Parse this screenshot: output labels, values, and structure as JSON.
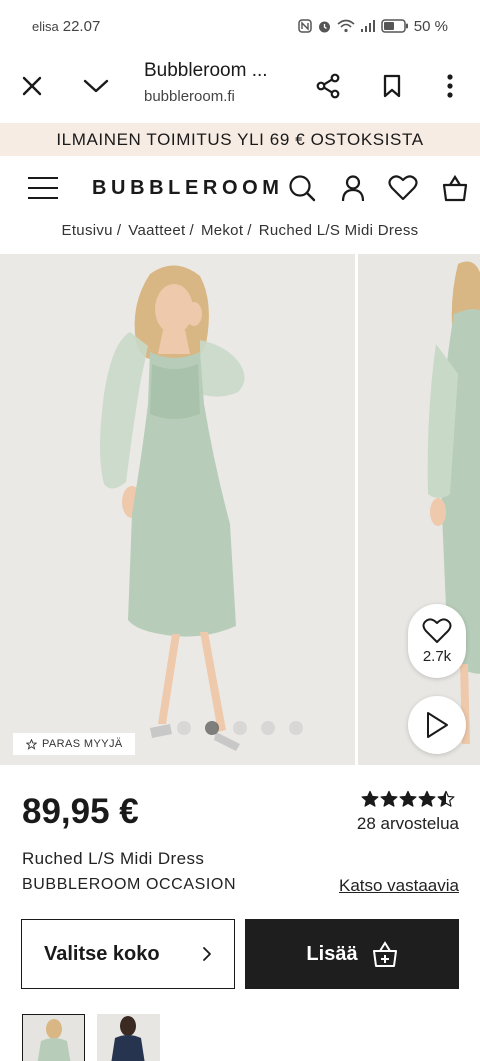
{
  "status": {
    "carrier": "elisa",
    "time": "22.07",
    "battery": "50 %"
  },
  "browser": {
    "title": "Bubbleroom ...",
    "domain": "bubbleroom.fi"
  },
  "promo": "ILMAINEN TOIMITUS YLI 69 € OSTOKSISTA",
  "site": {
    "logo": "BUBBLEROOM"
  },
  "breadcrumb": [
    {
      "label": "Etusivu"
    },
    {
      "label": "Vaatteet"
    },
    {
      "label": "Mekot"
    },
    {
      "label": "Ruched L/S Midi Dress"
    }
  ],
  "breadcrumb_separator": "/",
  "gallery": {
    "badge": "PARAS MYYJÄ",
    "dots_count": 5,
    "active_dot": 1,
    "favorites_count": "2.7k"
  },
  "product": {
    "price": "89,95 €",
    "rating": 4.5,
    "rating_max": 5,
    "reviews": "28 arvostelua",
    "name": "Ruched L/S Midi Dress",
    "brand": "BUBBLEROOM OCCASION",
    "similar_link": "Katso vastaavia",
    "size_button": "Valitse koko",
    "add_button": "Lisää"
  },
  "colors": {
    "promo_bg": "#f7ece4",
    "dress": "#b7cdb9",
    "primary_button": "#1e1e1e"
  }
}
